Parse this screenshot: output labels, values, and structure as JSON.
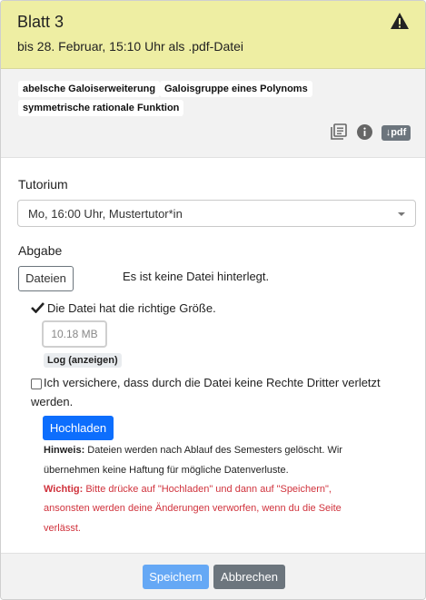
{
  "header": {
    "title": "Blatt 3",
    "deadline": "bis 28. Februar, 15:10 Uhr als .pdf-Datei",
    "warning_icon": "warning-triangle-icon"
  },
  "tags": [
    "abelsche Galoiserweiterung",
    "Galoisgruppe eines Polynoms",
    "symmetrische rationale Funktion"
  ],
  "toolbar": {
    "list_icon": "collection-icon",
    "info_icon": "info-icon",
    "pdf_badge": "↓pdf"
  },
  "tutorium": {
    "label": "Tutorium",
    "selected": "Mo, 16:00 Uhr, Mustertutor*in"
  },
  "abgabe": {
    "label": "Abgabe",
    "files_button": "Dateien",
    "no_file_text": "Es ist keine Datei hinterlegt.",
    "size_ok_text": "Die Datei hat die richtige Größe.",
    "size_value": "10.18 MB",
    "log_label": "Log (anzeigen)",
    "declaration_line1": "Ich versichere, dass durch die Datei keine Rechte Dritter verletzt",
    "declaration_line2": "werden.",
    "declaration_checked": false,
    "upload_button": "Hochladen",
    "hint_label": "Hinweis:",
    "hint_line1": "Dateien werden nach Ablauf des Semesters gelöscht. Wir",
    "hint_line2": "übernehmen keine Haftung für mögliche Datenverluste.",
    "important_label": "Wichtig:",
    "important_line1": "Bitte drücke auf \"Hochladen\" und dann auf \"Speichern\",",
    "important_line2": "ansonsten werden deine Änderungen verworfen, wenn du die Seite",
    "important_line3": "verlässt."
  },
  "footer": {
    "save_button": "Speichern",
    "cancel_button": "Abbrechen"
  },
  "colors": {
    "header_bg": "#eeeea3",
    "primary": "#0d6efd",
    "secondary": "#6c757d",
    "danger_text": "#d0323c"
  }
}
